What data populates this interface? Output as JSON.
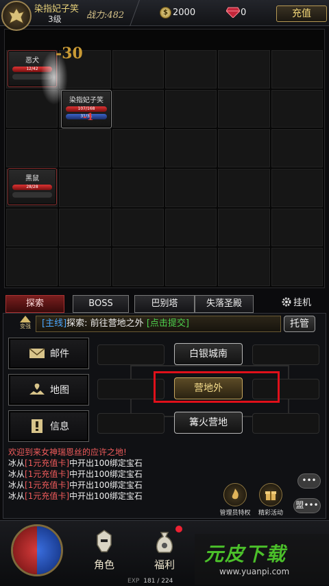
{
  "player": {
    "name": "染指妃子笑",
    "level": "3级",
    "power_label": "战力:",
    "power_value": "482"
  },
  "currency": {
    "gold_symbol": "$",
    "gold": "2000",
    "gems": "0",
    "recharge_label": "充值"
  },
  "battle": {
    "damage_top": "-30",
    "damage_hero": "-1",
    "units": [
      {
        "name": "恶犬",
        "hp": "12/42",
        "side": "enemy"
      },
      {
        "name": "染指妃子笑",
        "hp": "107/168",
        "mp": "31/31",
        "side": "player"
      },
      {
        "name": "黑鼠",
        "hp": "28/28",
        "side": "enemy"
      }
    ]
  },
  "tabs": {
    "items": [
      "探索",
      "BOSS",
      "巴别塔",
      "失落圣殿"
    ],
    "active_index": 0,
    "idle_label": "挂机"
  },
  "quest": {
    "upgrade_label": "变强",
    "tag": "[主线]",
    "text": "探索: 前往营地之外",
    "submit": "[点击提交]",
    "trustee_label": "托管"
  },
  "side_buttons": [
    {
      "label": "邮件",
      "icon": "mail-icon"
    },
    {
      "label": "地图",
      "icon": "map-icon"
    },
    {
      "label": "信息",
      "icon": "info-icon"
    }
  ],
  "map_nodes": {
    "north": "白银城南",
    "current": "营地外",
    "south": "篝火营地"
  },
  "chat": {
    "welcome": "欢迎到来女神瑞恩丝的应许之地!",
    "lines": [
      {
        "prefix": "冰从",
        "card": "[1元充值卡]",
        "suffix": "中开出100绑定宝石"
      },
      {
        "prefix": "冰从",
        "card": "[1元充值卡]",
        "suffix": "中开出100绑定宝石"
      },
      {
        "prefix": "冰从",
        "card": "[1元充值卡]",
        "suffix": "中开出100绑定宝石"
      },
      {
        "prefix": "冰从",
        "card": "[1元充值卡]",
        "suffix": "中开出100绑定宝石"
      }
    ]
  },
  "actions": {
    "admin": "管理员特权",
    "events": "精彩活动",
    "more": "•••",
    "chat_bubble": "盟•••"
  },
  "bottom_nav": {
    "role": "角色",
    "welfare": "福利"
  },
  "exp": {
    "label": "EXP",
    "value": "181 / 224"
  },
  "watermark": {
    "brand": "元皮下载",
    "url": "www.yuanpi.com"
  }
}
